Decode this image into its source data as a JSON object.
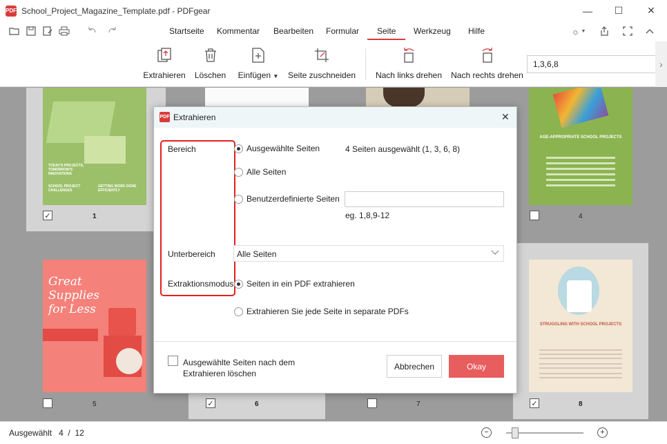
{
  "window": {
    "title": "School_Project_Magazine_Template.pdf - PDFgear",
    "logo_text": "PDF",
    "minimize": "—",
    "maximize": "☐",
    "close": "✕"
  },
  "quick_access": [
    "open-icon",
    "save-icon",
    "save-as-icon",
    "print-icon",
    "undo-icon",
    "redo-icon"
  ],
  "menu": {
    "items": [
      "Startseite",
      "Kommentar",
      "Bearbeiten",
      "Formular",
      "Seite",
      "Werkzeug",
      "Hilfe"
    ],
    "active": "Seite",
    "accent_color": "#d83b3b"
  },
  "ribbon": {
    "extract": "Extrahieren",
    "delete": "Löschen",
    "insert": "Einfügen",
    "crop": "Seite zuschneiden",
    "rotate_left": "Nach links drehen",
    "rotate_right": "Nach rechts drehen",
    "page_range_value": "1,3,6,8"
  },
  "thumbnails": {
    "pages": [
      {
        "num": "1",
        "checked": true,
        "title": "TODAY'S PROJECTS, TOMORROW'S INNOVATIONS",
        "subtitle": "SCHOOL PROJECT CHALLENGES",
        "extra": "GETTING WORK DONE EFFICIENTLY"
      },
      {
        "num": "4",
        "checked": false,
        "title": "AGE-APPROPRIATE SCHOOL PROJECTS"
      },
      {
        "num": "5",
        "checked": false,
        "title": "Great Supplies for Less"
      },
      {
        "num": "6",
        "checked": true
      },
      {
        "num": "7",
        "checked": false
      },
      {
        "num": "8",
        "checked": true,
        "title": "STRUGGLING WITH SCHOOL PROJECTS"
      }
    ]
  },
  "dialog": {
    "title": "Extrahieren",
    "bereich_label": "Bereich",
    "selected_pages": "Ausgewählte Seiten",
    "selected_info": "4  Seiten ausgewählt (1, 3, 6, 8)",
    "all_pages": "Alle Seiten",
    "custom_pages": "Benutzerdefinierte Seiten",
    "custom_value": "",
    "custom_hint": "eg. 1,8,9-12",
    "unterbereich_label": "Unterbereich",
    "unterbereich_value": "Alle Seiten",
    "mode_label": "Extraktionsmodus",
    "mode_single": "Seiten in ein PDF extrahieren",
    "mode_separate": "Extrahieren Sie jede Seite in separate PDFs",
    "delete_after_line1": "Ausgewählte Seiten nach dem",
    "delete_after_line2": "Extrahieren löschen",
    "cancel": "Abbrechen",
    "ok": "Okay",
    "ok_color": "#e85d5d"
  },
  "status": {
    "selected_label": "Ausgewählt",
    "current": "4",
    "separator": "/",
    "total": "12"
  }
}
